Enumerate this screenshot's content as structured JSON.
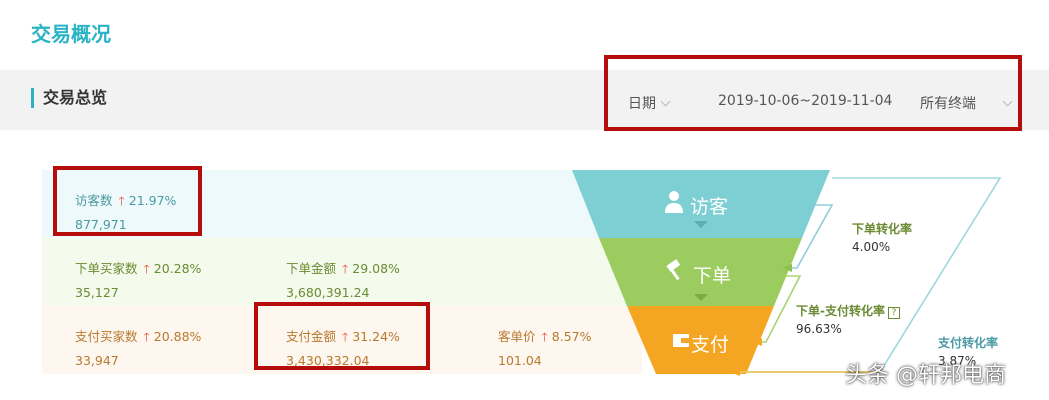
{
  "page": {
    "title": "交易概况"
  },
  "section": {
    "title": "交易总览"
  },
  "filters": {
    "date_label": "日期",
    "date_range": "2019-10-06~2019-11-04",
    "terminal": "所有终端"
  },
  "metrics": {
    "visitors": {
      "label": "访客数",
      "change": "21.97%",
      "value": "877,971"
    },
    "order_buyers": {
      "label": "下单买家数",
      "change": "20.28%",
      "value": "35,127"
    },
    "order_amount": {
      "label": "下单金额",
      "change": "29.08%",
      "value": "3,680,391.24"
    },
    "pay_buyers": {
      "label": "支付买家数",
      "change": "20.88%",
      "value": "33,947"
    },
    "pay_amount": {
      "label": "支付金额",
      "change": "31.24%",
      "value": "3,430,332.04"
    },
    "unit_price": {
      "label": "客单价",
      "change": "8.57%",
      "value": "101.04"
    }
  },
  "funnel": {
    "stages": [
      {
        "label": "访客",
        "icon": "user-icon",
        "color": "#7ecfd4"
      },
      {
        "label": "下单",
        "icon": "gavel-icon",
        "color": "#9ccc5f"
      },
      {
        "label": "支付",
        "icon": "wallet-icon",
        "color": "#f4a521"
      }
    ]
  },
  "rates": {
    "order_conversion": {
      "name": "下单转化率",
      "value": "4.00%"
    },
    "order_pay_conversion": {
      "name": "下单-支付转化率",
      "value": "96.63%"
    },
    "pay_conversion": {
      "name": "支付转化率",
      "value": "3.87%"
    }
  },
  "colors": {
    "accent": "#2ab3c4",
    "highlight": "#b50c0c",
    "up_arrow": "#e74c3c"
  },
  "watermark": "头条 @轩邦电商"
}
